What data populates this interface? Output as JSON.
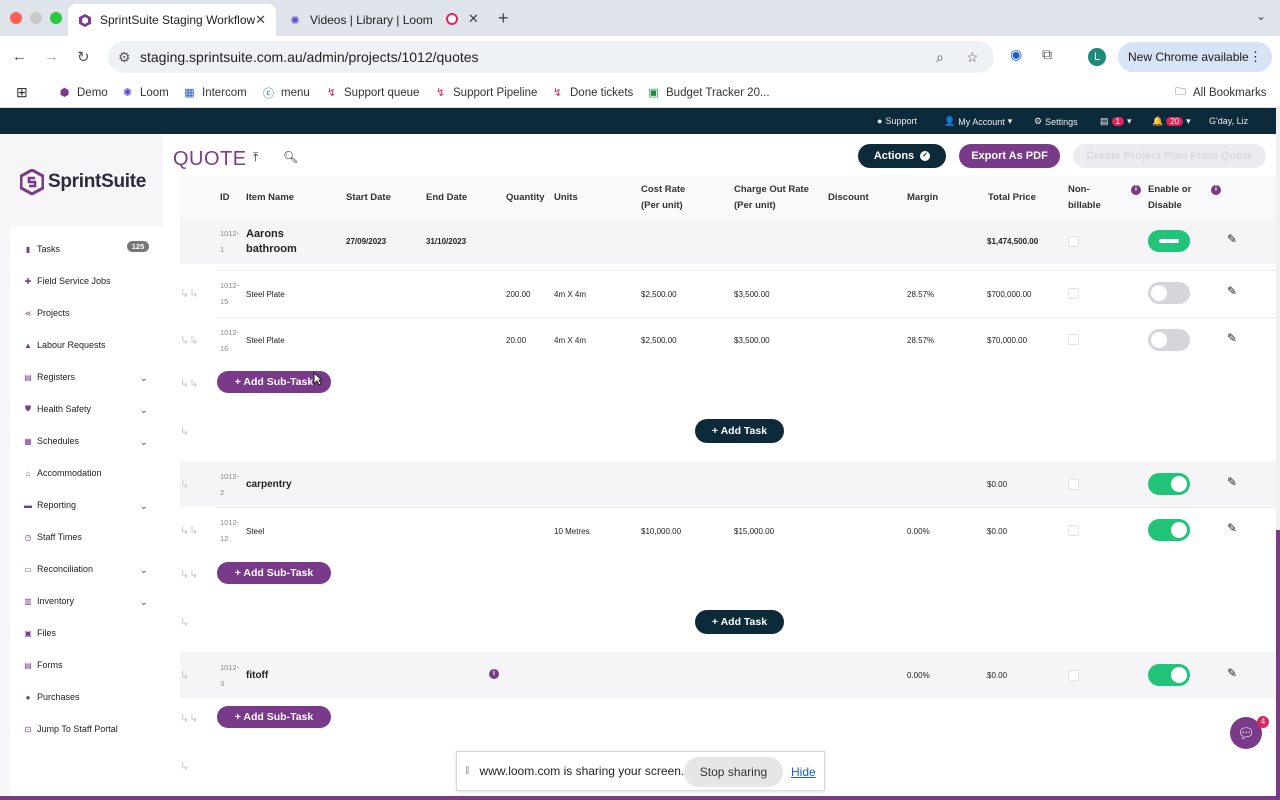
{
  "browser": {
    "tabs": [
      {
        "title": "SprintSuite Staging Workflow",
        "active": true
      },
      {
        "title": "Videos | Library | Loom",
        "active": false
      }
    ],
    "url": "staging.sprintsuite.com.au/admin/projects/1012/quotes",
    "profile_initial": "L",
    "update_label": "New Chrome available",
    "bookmarks": [
      "Demo",
      "Loom",
      "Intercom",
      "menu",
      "Support queue",
      "Support Pipeline",
      "Done tickets",
      "Budget Tracker 20..."
    ],
    "all_bookmarks": "All Bookmarks"
  },
  "appbar": {
    "support": "Support",
    "account": "My Account",
    "settings": "Settings",
    "doc_count": "1",
    "notif_count": "20",
    "greeting": "G'day, Liz"
  },
  "sidebar": {
    "brand": "SprintSuite",
    "tasks_badge": "125",
    "items": [
      {
        "label": "Tasks",
        "icon": "tasks-icon",
        "chevron": false
      },
      {
        "label": "Field Service Jobs",
        "icon": "field-service-icon",
        "chevron": false
      },
      {
        "label": "Projects",
        "icon": "projects-icon",
        "chevron": false
      },
      {
        "label": "Labour Requests",
        "icon": "labour-icon",
        "chevron": false
      },
      {
        "label": "Registers",
        "icon": "registers-icon",
        "chevron": true
      },
      {
        "label": "Health Safety",
        "icon": "shield-icon",
        "chevron": true
      },
      {
        "label": "Schedules",
        "icon": "schedules-icon",
        "chevron": true
      },
      {
        "label": "Accommodation",
        "icon": "home-icon",
        "chevron": false
      },
      {
        "label": "Reporting",
        "icon": "reporting-icon",
        "chevron": true
      },
      {
        "label": "Staff Times",
        "icon": "clock-icon",
        "chevron": false
      },
      {
        "label": "Reconciliation",
        "icon": "reconciliation-icon",
        "chevron": true
      },
      {
        "label": "Inventory",
        "icon": "inventory-icon",
        "chevron": true
      },
      {
        "label": "Files",
        "icon": "files-icon",
        "chevron": false
      },
      {
        "label": "Forms",
        "icon": "forms-icon",
        "chevron": false
      },
      {
        "label": "Purchases",
        "icon": "purchases-icon",
        "chevron": false
      },
      {
        "label": "Jump To Staff Portal",
        "icon": "portal-icon",
        "chevron": false
      }
    ]
  },
  "page": {
    "title": "QUOTE",
    "actions_label": "Actions",
    "export_label": "Export As PDF",
    "create_plan_label": "Create Project Plan From Quote"
  },
  "table": {
    "headers": {
      "id": "ID",
      "item_name": "Item Name",
      "start_date": "Start Date",
      "end_date": "End Date",
      "quantity": "Quantity",
      "units": "Units",
      "cost_rate": "Cost Rate",
      "cost_rate_sub": "(Per unit)",
      "charge_rate": "Charge Out Rate",
      "charge_rate_sub": "(Per unit)",
      "discount": "Discount",
      "margin": "Margin",
      "total_price": "Total Price",
      "non_billable": "Non-",
      "non_billable_sub": "billable",
      "enable": "Enable or",
      "enable_sub": "Disable"
    },
    "rows": {
      "r1": {
        "id1": "1012-",
        "id2": "1",
        "name": "Aarons bathroom",
        "start": "27/09/2023",
        "end": "31/10/2023",
        "total": "$1,474,500.00"
      },
      "r2": {
        "id1": "1012-",
        "id2": "15",
        "name": "Steel Plate",
        "qty": "200.00",
        "units": "4m X 4m",
        "cost": "$2,500.00",
        "charge": "$3,500.00",
        "margin": "28.57%",
        "total": "$700,000.00"
      },
      "r3": {
        "id1": "1012-",
        "id2": "16",
        "name": "Steel Plate",
        "qty": "20.00",
        "units": "4m X 4m",
        "cost": "$2,500.00",
        "charge": "$3,500.00",
        "margin": "28.57%",
        "total": "$70,000.00"
      },
      "r4": {
        "id1": "1012-",
        "id2": "2",
        "name": "carpentry",
        "total": "$0.00"
      },
      "r5": {
        "id1": "1012-",
        "id2": "12",
        "name": "Steel",
        "units": "10 Metres",
        "cost": "$10,000.00",
        "charge": "$15,000.00",
        "margin": "0.00%",
        "total": "$0.00"
      },
      "r6": {
        "id1": "1012-",
        "id2": "3",
        "name": "fitoff",
        "margin": "0.00%",
        "total": "$0.00"
      }
    },
    "add_subtask": "+ Add Sub-Task",
    "add_task": "+ Add Task"
  },
  "share_bar": {
    "message": "www.loom.com is sharing your screen.",
    "stop": "Stop sharing",
    "hide": "Hide"
  },
  "chat_badge": "4",
  "colors": {
    "brand": "#7a3a8a",
    "dark": "#0d2a3a",
    "toggle_on": "#22c47a",
    "toggle_off": "#d6d6da"
  }
}
